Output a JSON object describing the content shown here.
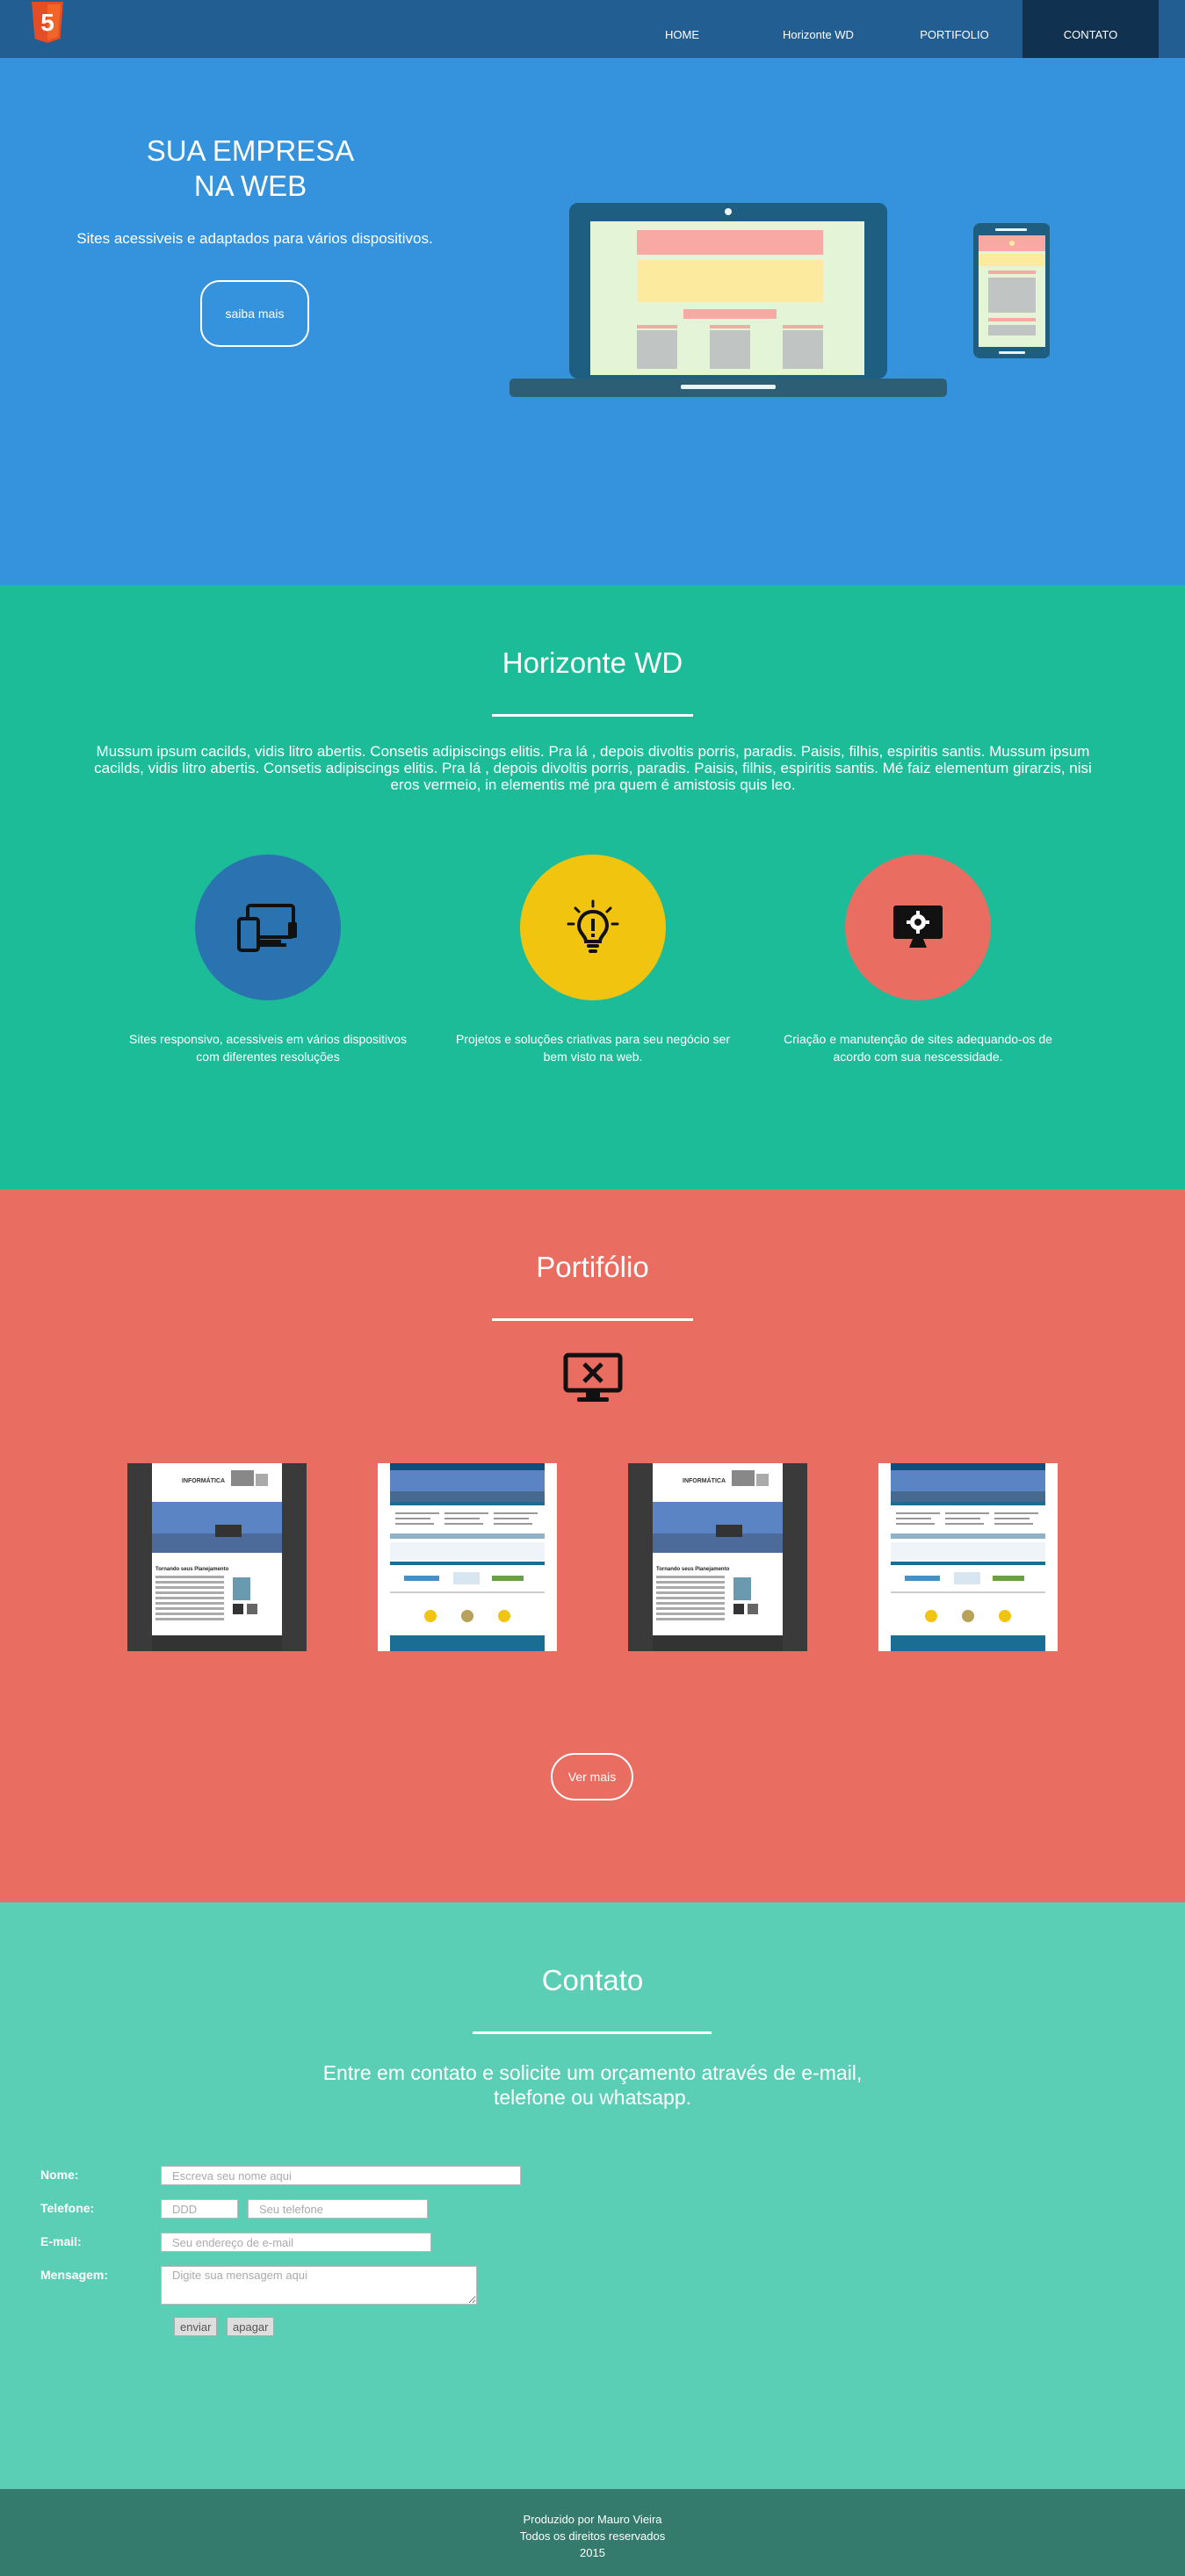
{
  "header": {
    "logo_text": "5",
    "nav": [
      {
        "label": "HOME"
      },
      {
        "label": "Horizonte WD"
      },
      {
        "label": "PORTIFOLIO"
      },
      {
        "label": "CONTATO"
      }
    ]
  },
  "hero": {
    "title_line1": "SUA EMPRESA",
    "title_line2": "NA WEB",
    "subtitle": "Sites acessiveis e adaptados para vários dispositivos.",
    "button": "saiba mais"
  },
  "about": {
    "title": "Horizonte WD",
    "text": "Mussum ipsum cacilds, vidis litro abertis. Consetis adipiscings elitis. Pra lá , depois divoltis porris, paradis. Paisis, filhis, espiritis santis. Mussum ipsum cacilds, vidis litro abertis. Consetis adipiscings elitis. Pra lá , depois divoltis porris, paradis. Paisis, filhis, espiritis santis. Mé faiz elementum girarzis, nisi eros vermeio, in elementis mé pra quem é amistosis quis leo.",
    "features": [
      {
        "text": "Sites responsivo, acessiveis em vários dispositivos com diferentes resoluções",
        "icon": "devices-icon",
        "color": "#2a73b0"
      },
      {
        "text": "Projetos e soluções criativas para seu negócio ser bem visto na web.",
        "icon": "lightbulb-icon",
        "color": "#f1c40f"
      },
      {
        "text": "Criação e manutenção de sites adequando-os de acordo com sua nescessidade.",
        "icon": "monitor-gear-icon",
        "color": "#ea6d61"
      }
    ]
  },
  "portfolio": {
    "title": "Portifólio",
    "icon": "monitor-x-icon",
    "thumb_brand": "INFORMÁTICA",
    "thumb_heading": "Tornando seus Planejamento",
    "button": "Ver mais"
  },
  "contact": {
    "title": "Contato",
    "subtitle_line1": "Entre em contato e solicite um orçamento através de e-mail,",
    "subtitle_line2": "telefone ou whatsapp.",
    "labels": {
      "name": "Nome:",
      "phone": "Telefone:",
      "email": "E-mail:",
      "message": "Mensagem:"
    },
    "placeholders": {
      "name": "Escreva seu nome aqui",
      "ddd": "DDD",
      "phone": "Seu telefone",
      "email": "Seu endereço de e-mail",
      "message": "Digite sua mensagem aqui"
    },
    "send": "enviar",
    "clear": "apagar"
  },
  "footer": {
    "line1": "Produzido por Mauro Vieira",
    "line2": "Todos os direitos reservados",
    "line3": "2015"
  }
}
